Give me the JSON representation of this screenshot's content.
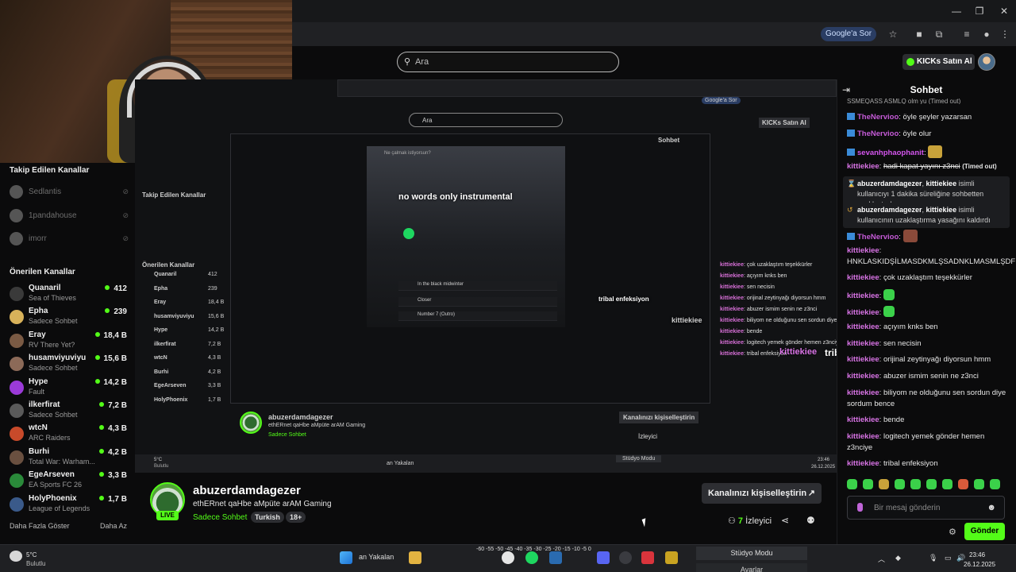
{
  "browser": {
    "google_sor": "Google'a Sor"
  },
  "kick_header": {
    "search_placeholder": "Ara",
    "kicks_button": "KICKs Satın Al"
  },
  "sidebar": {
    "followed_title": "Takip Edilen Kanallar",
    "followed": [
      {
        "name": "Sedlantis"
      },
      {
        "name": "1pandahouse"
      },
      {
        "name": "imorr"
      }
    ],
    "recommended_title": "Önerilen Kanallar",
    "recommended": [
      {
        "name": "Quanaril",
        "category": "Sea of Thieves",
        "viewers": "412",
        "color": "#3a3a3a"
      },
      {
        "name": "Epha",
        "category": "Sadece Sohbet",
        "viewers": "239",
        "color": "#d8b25a"
      },
      {
        "name": "Eray",
        "category": "RV There Yet?",
        "viewers": "18,4 B",
        "color": "#7a5a44"
      },
      {
        "name": "husamviyuviyu",
        "category": "Sadece Sohbet",
        "viewers": "15,6 B",
        "color": "#8c6a58"
      },
      {
        "name": "Hype",
        "category": "Fault",
        "viewers": "14,2 B",
        "color": "#9b3ad8"
      },
      {
        "name": "ilkerfirat",
        "category": "Sadece Sohbet",
        "viewers": "7,2 B",
        "color": "#5a5a5a"
      },
      {
        "name": "wtcN",
        "category": "ARC Raiders",
        "viewers": "4,3 B",
        "color": "#c84a2a"
      },
      {
        "name": "Burhi",
        "category": "Total War: Warham...",
        "viewers": "4,2 B",
        "color": "#6a5040"
      },
      {
        "name": "EgeArseven",
        "category": "EA Sports FC 26",
        "viewers": "3,3 B",
        "color": "#2a8a3a"
      },
      {
        "name": "HolyPhoenix",
        "category": "League of Legends",
        "viewers": "1,7 B",
        "color": "#3a5a8a"
      }
    ],
    "show_more": "Daha Fazla Göster",
    "show_less": "Daha Az"
  },
  "nested": {
    "spotify_search": "Ne çalmak istiyorsun?",
    "playlist_title": "no words only instrumental",
    "tracks": [
      "Closer",
      "Number 7 (Outro)",
      "In the black midwinter"
    ],
    "overlay_text_1": "tribal enfeksiyon",
    "overlay_user": "kittiekiee",
    "overlay_text_2": "tribal enfeksiyon"
  },
  "stream": {
    "streamer": "abuzerdamdagezer",
    "live": "LIVE",
    "title": "ethERnet qaHbe aMpüte arAM Gaming",
    "category": "Sadece Sohbet",
    "tags": [
      "Turkish",
      "18+"
    ],
    "customize": "Kanalınızı kişiselleştirin",
    "viewers_count": "7",
    "viewers_label": "İzleyici"
  },
  "chat": {
    "title": "Sohbet",
    "top_partial": "SSMEQASS ASMLQ olm yu (Timed out)",
    "messages": [
      {
        "user": "TheNervioo",
        "text": "öyle şeyler yazarsan",
        "badge": true,
        "cls": "u-nervio"
      },
      {
        "user": "TheNervioo",
        "text": "öyle olur",
        "badge": true,
        "cls": "u-nervio"
      },
      {
        "user": "sevanhphaophanit",
        "text": "",
        "badge": true,
        "cls": "u-sev"
      }
    ],
    "timeout_user": "kittiekiee",
    "timeout_text": "hadi kapat yayını z3nci",
    "timeout_tag": "(Timed out)",
    "sys1_mod": "abuzerdamdagezer",
    "sys1_user": "kittiekiee",
    "sys1_text": "isimli kullanıcıyı 1 dakika süreliğine sohbetten uzaklaştırdı",
    "sys2_mod": "abuzerdamdagezer",
    "sys2_user": "kittiekiee",
    "sys2_text": "isimli kullanıcının uzaklaştırma yasağını kaldırdı",
    "nervio3": "TheNervioo",
    "k_user": "kittiekiee",
    "k_long": "HNKLASKIDŞİLMASDKMLŞSADNKLMASMLŞDF",
    "k_msgs": [
      "çok uzaklaştım teşekkürler",
      "açıyım knks ben",
      "sen necisin",
      "orijinal zeytinyağı diyorsun hmm",
      "abuzer ismim senin ne z3nci",
      "biliyom ne olduğunu sen sordun diye sordum bence",
      "bende",
      "logitech yemek gönder hemen z3nciye",
      "tribal enfeksiyon"
    ],
    "input_placeholder": "Bir mesaj gönderin",
    "send": "Gönder"
  },
  "taskbar": {
    "temp": "5°C",
    "weather": "Bulutlu",
    "studio": "Stüdyo Modu",
    "settings": "Ayarlar",
    "time": "23:46",
    "date": "26.12.2025",
    "taskbar_text": "an Yakalan",
    "mixer_scale": "-60 -55 -50 -45 -40 -35 -30 -25 -20 -15 -10 -5 0"
  },
  "colors": {
    "accent": "#53fc18"
  }
}
